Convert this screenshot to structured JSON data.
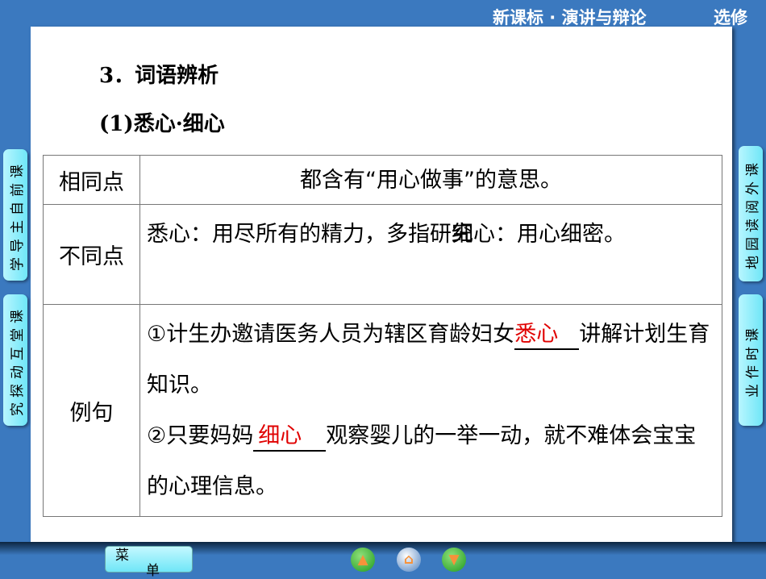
{
  "header": {
    "course": "新课标 · 演讲与辩论",
    "volume": "选修"
  },
  "content": {
    "section_title": "3．词语辨析",
    "subtitle": "(1)悉心·细心",
    "table": {
      "rows": [
        {
          "label": "相同点",
          "text": "都含有“用心做事”的意思。"
        },
        {
          "label": "不同点",
          "text_a": "悉心：用尽所有的精力，多指研究",
          "text_b": "细心：用心细密。"
        },
        {
          "label": "例句",
          "s1_pre": "①计生办邀请医务人员为辖区育龄妇女",
          "s1_answer": "悉心",
          "s1_post": "讲解计划生育知识。",
          "s2_pre": "②只要妈妈",
          "s2_answer": "细心",
          "s2_post": "观察婴儿的一举一动，就不难体会宝宝的心理信息。"
        }
      ]
    }
  },
  "side_tabs": {
    "left": [
      "学导主自前课",
      "究探动互堂课"
    ],
    "right": [
      "地园读阅外课",
      "业作时课"
    ]
  },
  "footer": {
    "menu_a": "菜",
    "menu_b": "单",
    "prev": "prev-icon",
    "home": "home-icon",
    "next": "next-icon"
  },
  "colors": {
    "background": "#3b79bf",
    "answer": "#e00000",
    "tab": "#6fe6f7"
  }
}
